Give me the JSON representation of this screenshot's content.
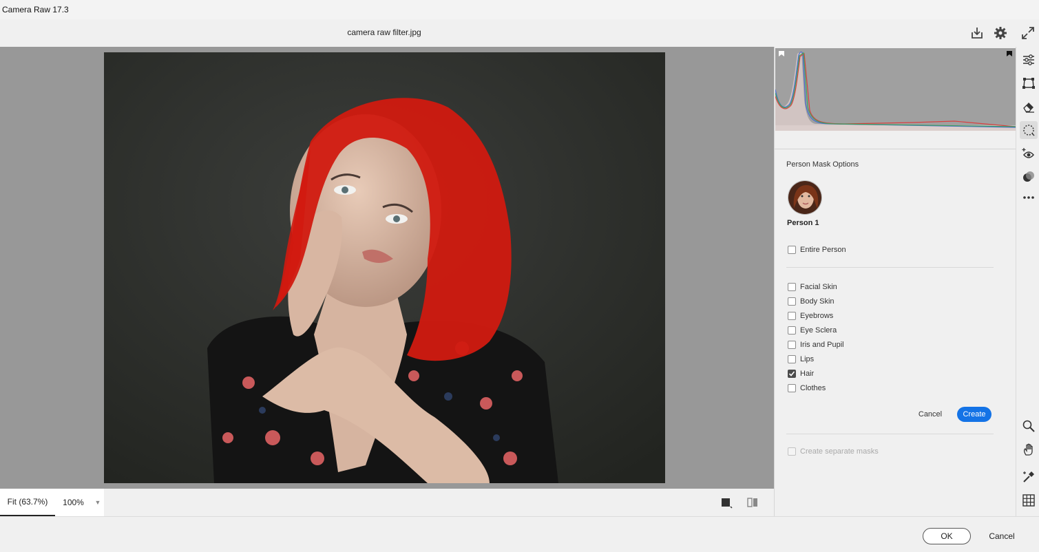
{
  "app": {
    "title": "Camera Raw 17.3"
  },
  "toolbar": {
    "file_name": "camera raw filter.jpg",
    "icons": [
      "save-icon",
      "gear-icon",
      "fullscreen-icon"
    ]
  },
  "bottombar": {
    "zoom_fit": "Fit (63.7%)",
    "zoom_100": "100%",
    "view_icons": [
      "view-mode-icon",
      "before-after-icon"
    ]
  },
  "panel": {
    "title": "Person Mask Options",
    "person_name": "Person 1",
    "entire_person": {
      "label": "Entire Person",
      "checked": false
    },
    "parts": [
      {
        "label": "Facial Skin",
        "checked": false
      },
      {
        "label": "Body Skin",
        "checked": false
      },
      {
        "label": "Eyebrows",
        "checked": false
      },
      {
        "label": "Eye Sclera",
        "checked": false
      },
      {
        "label": "Iris and Pupil",
        "checked": false
      },
      {
        "label": "Lips",
        "checked": false
      },
      {
        "label": "Hair",
        "checked": true
      },
      {
        "label": "Clothes",
        "checked": false
      }
    ],
    "cancel_label": "Cancel",
    "create_label": "Create",
    "separate_masks": {
      "label": "Create separate masks",
      "checked": false,
      "disabled": true
    }
  },
  "rail": {
    "top_tools": [
      "edit-sliders-icon",
      "crop-icon",
      "eraser-icon",
      "masking-icon",
      "red-eye-icon",
      "presets-icon",
      "more-icon"
    ],
    "active_tool": "masking-icon",
    "bottom_tools": [
      "zoom-icon",
      "hand-icon",
      "sampler-icon",
      "grid-icon"
    ]
  },
  "footer": {
    "ok_label": "OK",
    "cancel_label": "Cancel"
  },
  "colors": {
    "accent": "#1473e6",
    "mask_overlay": "#d11a10",
    "canvas_bg": "#989898",
    "photo_bg": "#2e302d"
  }
}
